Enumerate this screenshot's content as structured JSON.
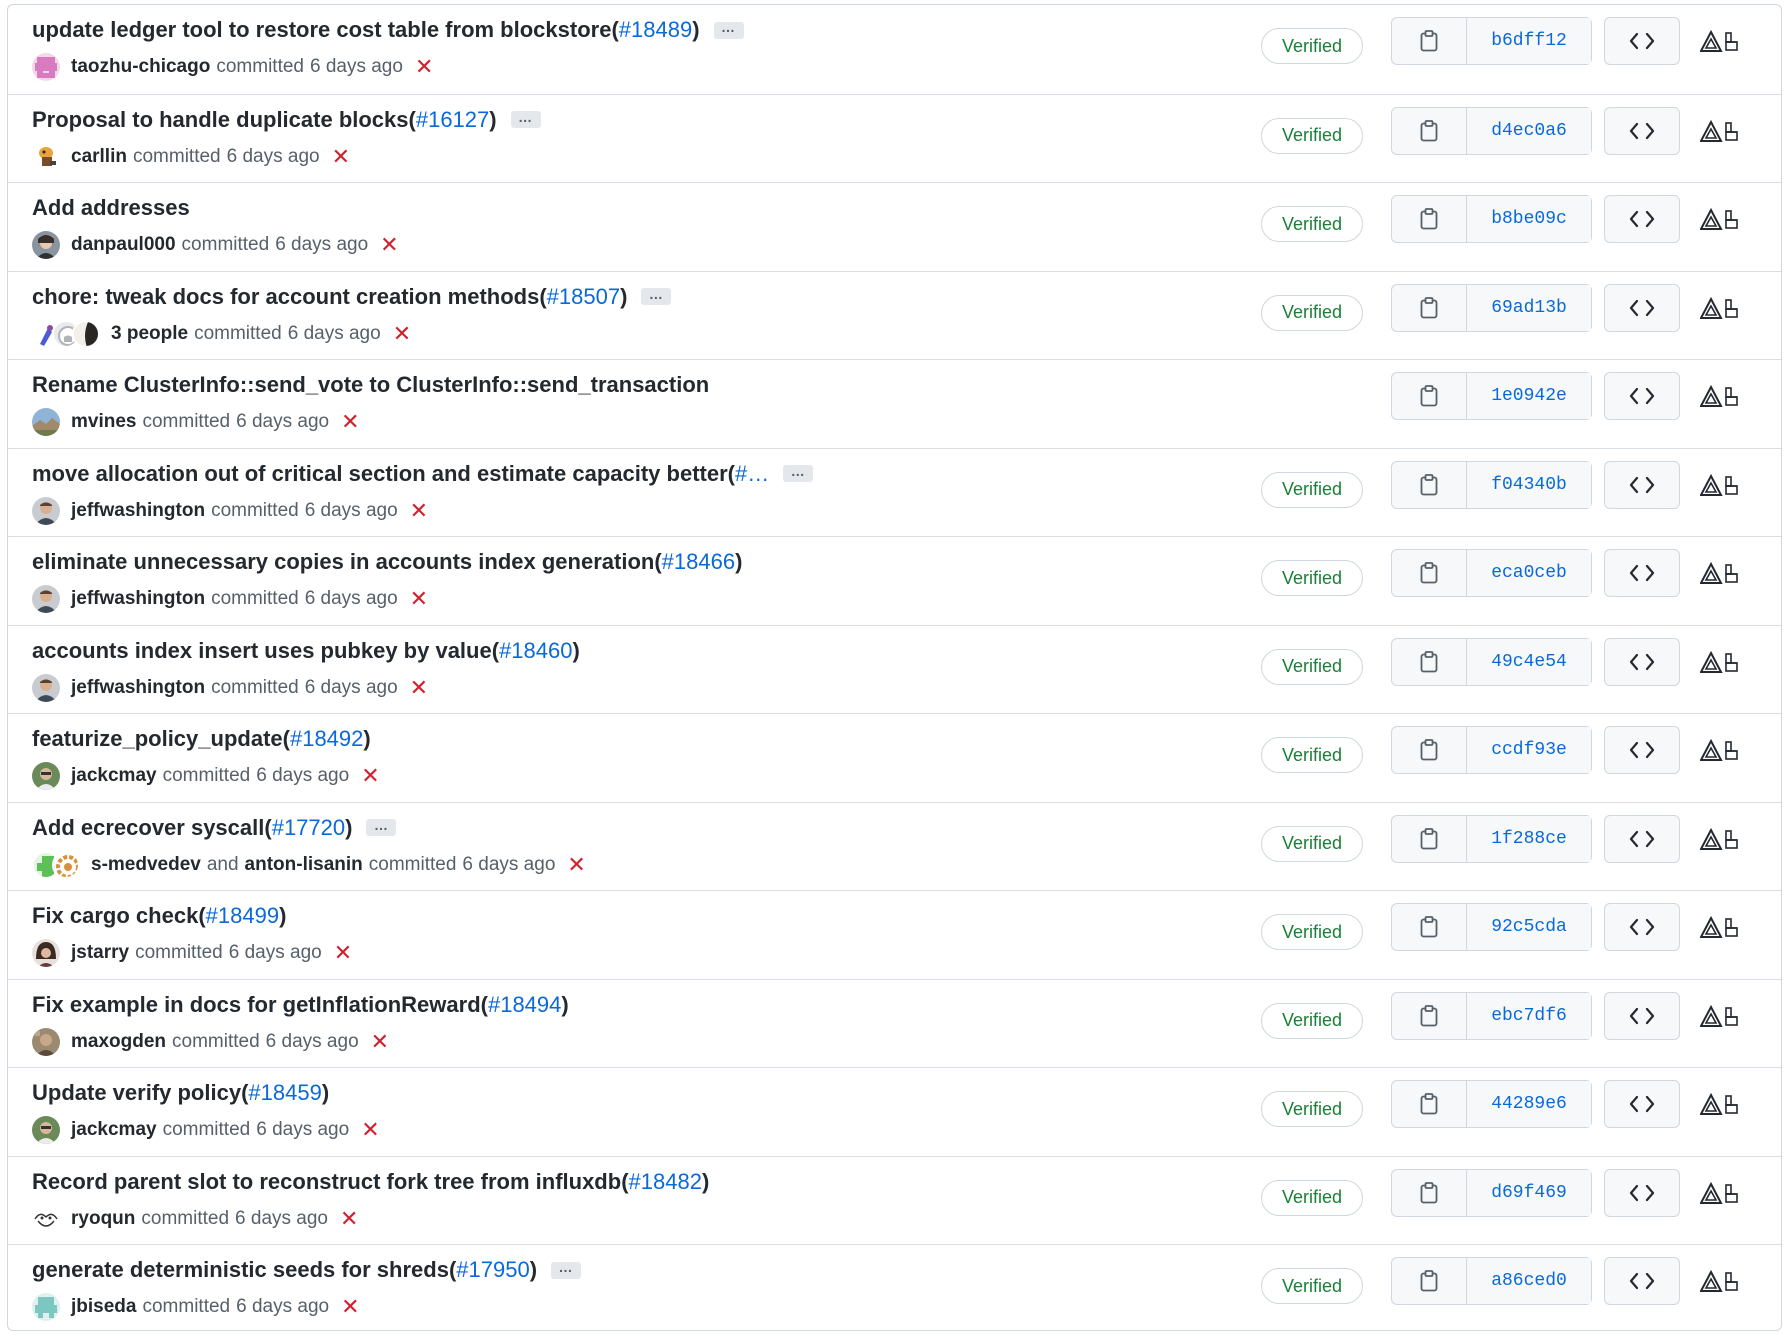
{
  "labels": {
    "committed": "committed",
    "verified": "Verified",
    "and": "and",
    "ellipsis": "…"
  },
  "commits": [
    {
      "title": "update ledger tool to restore cost table from blockstore",
      "pr": "#18489",
      "expander": true,
      "authors": [
        "taozhu-chicago"
      ],
      "time": "6 days ago",
      "verified": true,
      "sha": "b6dff12",
      "avatar": "pink-pixel"
    },
    {
      "title": "Proposal to handle duplicate blocks",
      "pr": "#16127",
      "expander": true,
      "authors": [
        "carllin"
      ],
      "time": "6 days ago",
      "verified": true,
      "sha": "d4ec0a6",
      "avatar": "cartoon"
    },
    {
      "title": "Add addresses",
      "pr": "",
      "expander": false,
      "authors": [
        "danpaul000"
      ],
      "time": "6 days ago",
      "verified": true,
      "sha": "b8be09c",
      "avatar": "photo-dark"
    },
    {
      "title": "chore: tweak docs for account creation methods",
      "pr": "#18507",
      "expander": true,
      "authors": [
        "3 people"
      ],
      "time": "6 days ago",
      "verified": true,
      "sha": "69ad13b",
      "avatar": "stack"
    },
    {
      "title": "Rename ClusterInfo::send_vote to ClusterInfo::send_transaction",
      "pr": "",
      "expander": false,
      "authors": [
        "mvines"
      ],
      "time": "6 days ago",
      "verified": false,
      "sha": "1e0942e",
      "avatar": "landscape"
    },
    {
      "title": "move allocation out of critical section and estimate capacity better",
      "pr": "#…",
      "expander": true,
      "authors": [
        "jeffwashington"
      ],
      "time": "6 days ago",
      "verified": true,
      "sha": "f04340b",
      "avatar": "photo-man"
    },
    {
      "title": "eliminate unnecessary copies in accounts index generation",
      "pr": "#18466",
      "expander": false,
      "authors": [
        "jeffwashington"
      ],
      "time": "6 days ago",
      "verified": true,
      "sha": "eca0ceb",
      "avatar": "photo-man"
    },
    {
      "title": "accounts index insert uses pubkey by value",
      "pr": "#18460",
      "expander": false,
      "authors": [
        "jeffwashington"
      ],
      "time": "6 days ago",
      "verified": true,
      "sha": "49c4e54",
      "avatar": "photo-man"
    },
    {
      "title": "featurize_policy_update",
      "pr": "#18492",
      "expander": false,
      "authors": [
        "jackcmay"
      ],
      "time": "6 days ago",
      "verified": true,
      "sha": "ccdf93e",
      "avatar": "photo-green"
    },
    {
      "title": "Add ecrecover syscall",
      "pr": "#17720",
      "expander": true,
      "authors": [
        "s-medvedev",
        "anton-lisanin"
      ],
      "time": "6 days ago",
      "verified": true,
      "sha": "1f288ce",
      "avatar": "pair"
    },
    {
      "title": "Fix cargo check",
      "pr": "#18499",
      "expander": false,
      "authors": [
        "jstarry"
      ],
      "time": "6 days ago",
      "verified": true,
      "sha": "92c5cda",
      "avatar": "photo-hair"
    },
    {
      "title": "Fix example in docs for getInflationReward",
      "pr": "#18494",
      "expander": false,
      "authors": [
        "maxogden"
      ],
      "time": "6 days ago",
      "verified": true,
      "sha": "ebc7df6",
      "avatar": "photo-brown"
    },
    {
      "title": "Update verify policy",
      "pr": "#18459",
      "expander": false,
      "authors": [
        "jackcmay"
      ],
      "time": "6 days ago",
      "verified": true,
      "sha": "44289e6",
      "avatar": "photo-green"
    },
    {
      "title": "Record parent slot to reconstruct fork tree from influxdb",
      "pr": "#18482",
      "expander": false,
      "authors": [
        "ryoqun"
      ],
      "time": "6 days ago",
      "verified": true,
      "sha": "d69f469",
      "avatar": "sketch"
    },
    {
      "title": "generate deterministic seeds for shreds",
      "pr": "#17950",
      "expander": true,
      "authors": [
        "jbiseda"
      ],
      "time": "6 days ago",
      "verified": true,
      "sha": "a86ced0",
      "avatar": "teal-pixel"
    }
  ],
  "icons": {
    "copy": "clipboard-icon",
    "browse": "code-icon",
    "deploy": "deploy-status-icon",
    "failed": "x-icon"
  },
  "colors": {
    "link": "#0969da",
    "verified": "#1a7f37",
    "failed": "#cf222e",
    "border": "#d0d7de"
  }
}
